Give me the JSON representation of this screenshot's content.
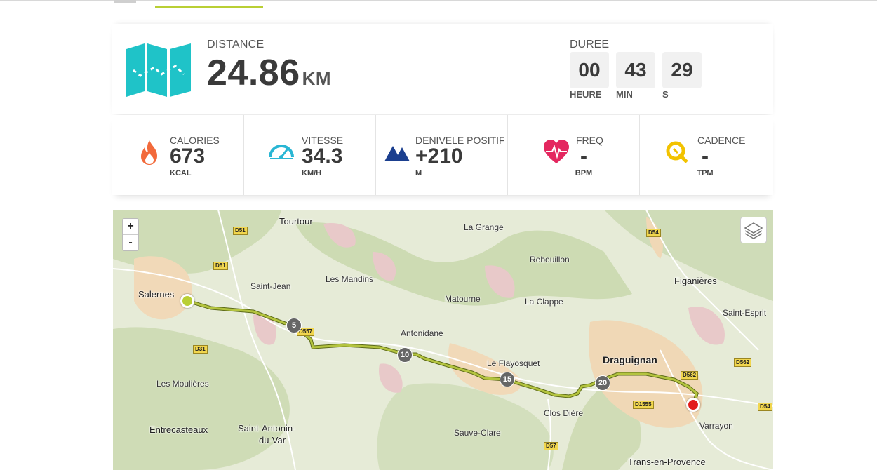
{
  "summary": {
    "distance_label": "DISTANCE",
    "distance_value": "24.86",
    "distance_unit": "KM",
    "duration_label": "DUREE",
    "hours": "00",
    "minutes": "43",
    "seconds": "29",
    "hours_unit": "HEURE",
    "minutes_unit": "MIN",
    "seconds_unit": "S"
  },
  "stats": [
    {
      "label": "CALORIES",
      "value": "673",
      "unit": "KCAL",
      "icon": "flame-icon",
      "color": "#f26a3b"
    },
    {
      "label": "VITESSE",
      "value": "34.3",
      "unit": "KM/H",
      "icon": "speedometer-icon",
      "color": "#29b6d4"
    },
    {
      "label": "DENIVELE POSITIF",
      "value": "+210",
      "unit": "M",
      "icon": "mountain-icon",
      "color": "#1b3f8f"
    },
    {
      "label": "FREQ",
      "value": "-",
      "unit": "BPM",
      "icon": "heart-rate-icon",
      "color": "#e4275f"
    },
    {
      "label": "CADENCE",
      "value": "-",
      "unit": "TPM",
      "icon": "cadence-icon",
      "color": "#f2c200"
    }
  ],
  "map": {
    "zoom_in": "+",
    "zoom_out": "-",
    "places": [
      "Tourtour",
      "La Grange",
      "Rebouillon",
      "Figanières",
      "Salernes",
      "Saint-Jean",
      "Les Mandins",
      "Matourne",
      "La Clappe",
      "Saint-Esprit",
      "Antonidane",
      "Le Flayosquet",
      "Draguignan",
      "Les Moulières",
      "Entrecasteaux",
      "Saint-Antonin-",
      "du-Var",
      "Sauve-Clare",
      "Clos Dière",
      "Varrayon",
      "Trans-en-Provence"
    ],
    "roads": [
      "D51",
      "D51",
      "D54",
      "D557",
      "D31",
      "D562",
      "D562",
      "D1555",
      "D57",
      "D54"
    ],
    "km_markers": [
      "5",
      "10",
      "15",
      "20"
    ],
    "colors": {
      "track": "#9aa83a",
      "start": "#b9cf34",
      "end": "#e21b1b"
    }
  }
}
